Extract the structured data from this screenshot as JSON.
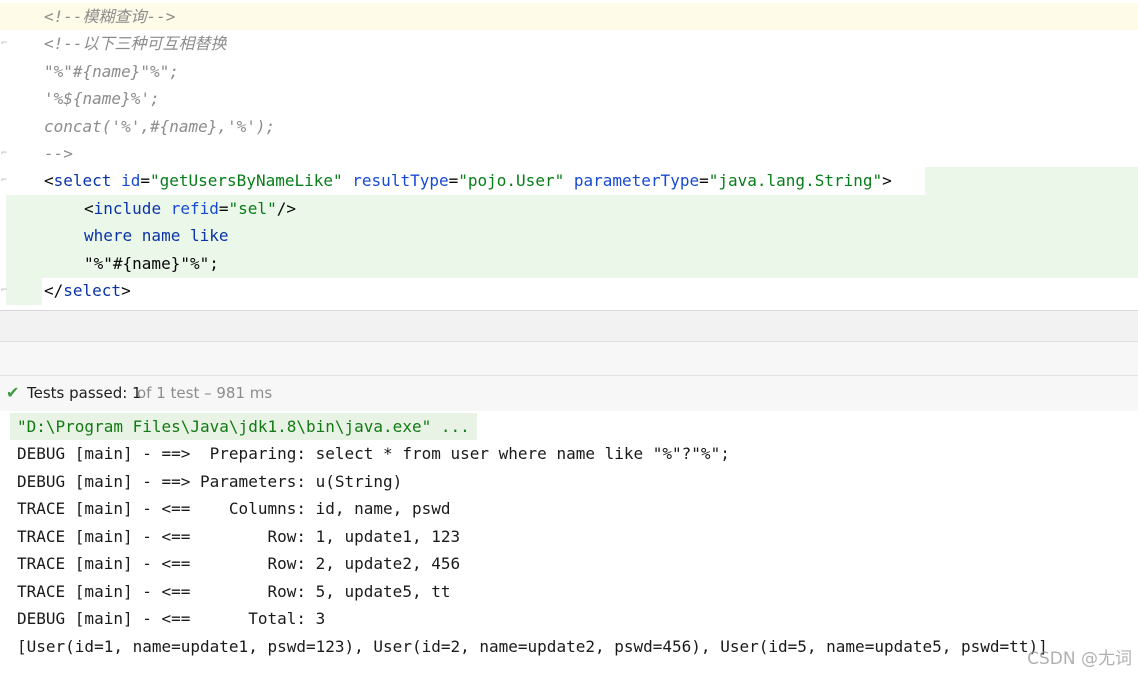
{
  "editor": {
    "lines": [
      {
        "parts": [
          {
            "t": "<!--模糊查询-->",
            "c": "c-comment"
          }
        ]
      },
      {
        "parts": [
          {
            "t": "<!--以下三种可互相替换",
            "c": "c-comment"
          }
        ]
      },
      {
        "parts": [
          {
            "t": "\"%\"#{name}\"%\";",
            "c": "c-comment"
          }
        ]
      },
      {
        "parts": [
          {
            "t": "'%${name}%';",
            "c": "c-comment"
          }
        ]
      },
      {
        "parts": [
          {
            "t": "concat('%',#{name},'%');",
            "c": "c-comment"
          }
        ]
      },
      {
        "parts": [
          {
            "t": "-->",
            "c": "c-comment"
          }
        ]
      },
      {
        "parts": [
          {
            "t": "<",
            "c": "c-punct"
          },
          {
            "t": "select",
            "c": "c-tag"
          },
          {
            "t": " ",
            "c": "c-text"
          },
          {
            "t": "id",
            "c": "c-attr"
          },
          {
            "t": "=",
            "c": "c-punct"
          },
          {
            "t": "\"getUsersByNameLike\"",
            "c": "c-str"
          },
          {
            "t": " ",
            "c": "c-text"
          },
          {
            "t": "resultType",
            "c": "c-attr"
          },
          {
            "t": "=",
            "c": "c-punct"
          },
          {
            "t": "\"pojo.User\"",
            "c": "c-str"
          },
          {
            "t": " ",
            "c": "c-text"
          },
          {
            "t": "parameterType",
            "c": "c-attr"
          },
          {
            "t": "=",
            "c": "c-punct"
          },
          {
            "t": "\"java.lang.String\"",
            "c": "c-str"
          },
          {
            "t": ">",
            "c": "c-punct"
          }
        ]
      },
      {
        "parts": [
          {
            "t": "<",
            "c": "c-punct"
          },
          {
            "t": "include",
            "c": "c-tag"
          },
          {
            "t": " ",
            "c": "c-text"
          },
          {
            "t": "refid",
            "c": "c-attr"
          },
          {
            "t": "=",
            "c": "c-punct"
          },
          {
            "t": "\"sel\"",
            "c": "c-str"
          },
          {
            "t": "/>",
            "c": "c-punct"
          }
        ]
      },
      {
        "parts": [
          {
            "t": "where name like",
            "c": "c-kw"
          }
        ]
      },
      {
        "parts": [
          {
            "t": "\"%\"#{name}\"%\";",
            "c": "c-text"
          }
        ]
      },
      {
        "parts": [
          {
            "t": "</",
            "c": "c-punct"
          },
          {
            "t": "select",
            "c": "c-tag"
          },
          {
            "t": ">",
            "c": "c-punct"
          }
        ]
      }
    ]
  },
  "test_status": {
    "check_icon": "check-icon",
    "passed_label": "Tests passed: 1",
    "detail": "of 1 test – 981 ms",
    "color": "#3f9a3f"
  },
  "console": {
    "command": "\"D:\\Program Files\\Java\\jdk1.8\\bin\\java.exe\" ...",
    "lines": [
      "DEBUG [main] - ==>  Preparing: select * from user where name like \"%\"?\"%\";",
      "DEBUG [main] - ==> Parameters: u(String)",
      "TRACE [main] - <==    Columns: id, name, pswd",
      "TRACE [main] - <==        Row: 1, update1, 123",
      "TRACE [main] - <==        Row: 2, update2, 456",
      "TRACE [main] - <==        Row: 5, update5, tt",
      "DEBUG [main] - <==      Total: 3",
      "[User(id=1, name=update1, pswd=123), User(id=2, name=update2, pswd=456), User(id=5, name=update5, pswd=tt)]"
    ]
  },
  "watermark": "CSDN @尢词"
}
